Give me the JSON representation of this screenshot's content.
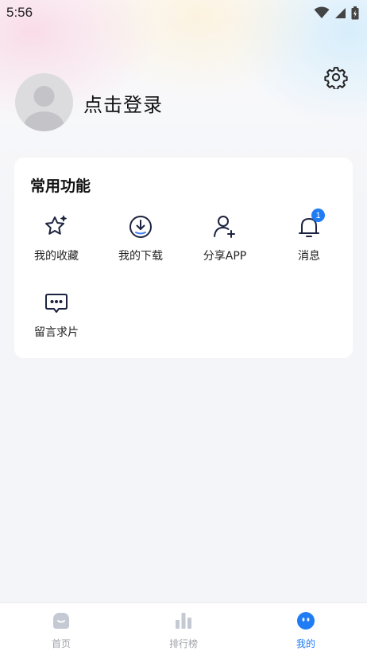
{
  "status_bar": {
    "time": "5:56"
  },
  "profile": {
    "login_label": "点击登录"
  },
  "common_functions": {
    "title": "常用功能",
    "items": [
      {
        "label": "我的收藏",
        "icon": "star-sparkle-icon"
      },
      {
        "label": "我的下载",
        "icon": "download-icon"
      },
      {
        "label": "分享APP",
        "icon": "add-user-icon"
      },
      {
        "label": "消息",
        "icon": "bell-icon",
        "badge": "1"
      },
      {
        "label": "留言求片",
        "icon": "chat-bubble-icon"
      }
    ]
  },
  "tabbar": {
    "items": [
      {
        "label": "首页",
        "icon": "home-icon",
        "active": false
      },
      {
        "label": "排行榜",
        "icon": "ranking-bars-icon",
        "active": false
      },
      {
        "label": "我的",
        "icon": "profile-face-icon",
        "active": true
      }
    ]
  },
  "colors": {
    "accent": "#1f7cf5",
    "badge": "#1f7cf5",
    "inactive_tab": "#a0a3ab"
  }
}
